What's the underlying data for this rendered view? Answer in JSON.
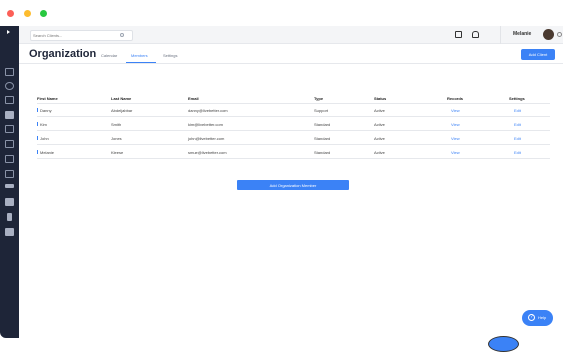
{
  "topbar": {
    "search_placeholder": "Search Clients...",
    "user_name": "Melanie"
  },
  "header": {
    "title": "Organization",
    "tabs": [
      {
        "label": "Calendar"
      },
      {
        "label": "Members",
        "active": true
      },
      {
        "label": "Settings"
      }
    ],
    "add_client_label": "Add Client"
  },
  "table": {
    "columns": [
      "First Name",
      "Last Name",
      "Email",
      "Type",
      "Status",
      "Records",
      "Settings"
    ],
    "rows": [
      {
        "first": "Danny",
        "last": "Abdeljabbar",
        "email": "danny@livebetter.com",
        "type": "Support",
        "status": "Active",
        "records": "View",
        "settings": "Edit"
      },
      {
        "first": "Kim",
        "last": "Smith",
        "email": "kim@livebetter.com",
        "type": "Standard",
        "status": "Active",
        "records": "View",
        "settings": "Edit"
      },
      {
        "first": "John",
        "last": "Jones",
        "email": "john@livebetter.com",
        "type": "Standard",
        "status": "Active",
        "records": "View",
        "settings": "Edit"
      },
      {
        "first": "Melanie",
        "last": "Kleese",
        "email": "smue@livebetter.com",
        "type": "Standard",
        "status": "Active",
        "records": "View",
        "settings": "Edit"
      }
    ]
  },
  "add_member_label": "Add Organization Member",
  "help_label": "Help",
  "colors": {
    "accent": "#3b82f6",
    "sidebar": "#1e2538"
  },
  "sidebar_icons": [
    "home-icon",
    "search-icon",
    "link-icon",
    "building-icon",
    "group-icon",
    "calendar-icon",
    "inbox-icon",
    "clipboard-icon",
    "truck-icon",
    "doc-icon",
    "bars-icon",
    "note-icon"
  ]
}
